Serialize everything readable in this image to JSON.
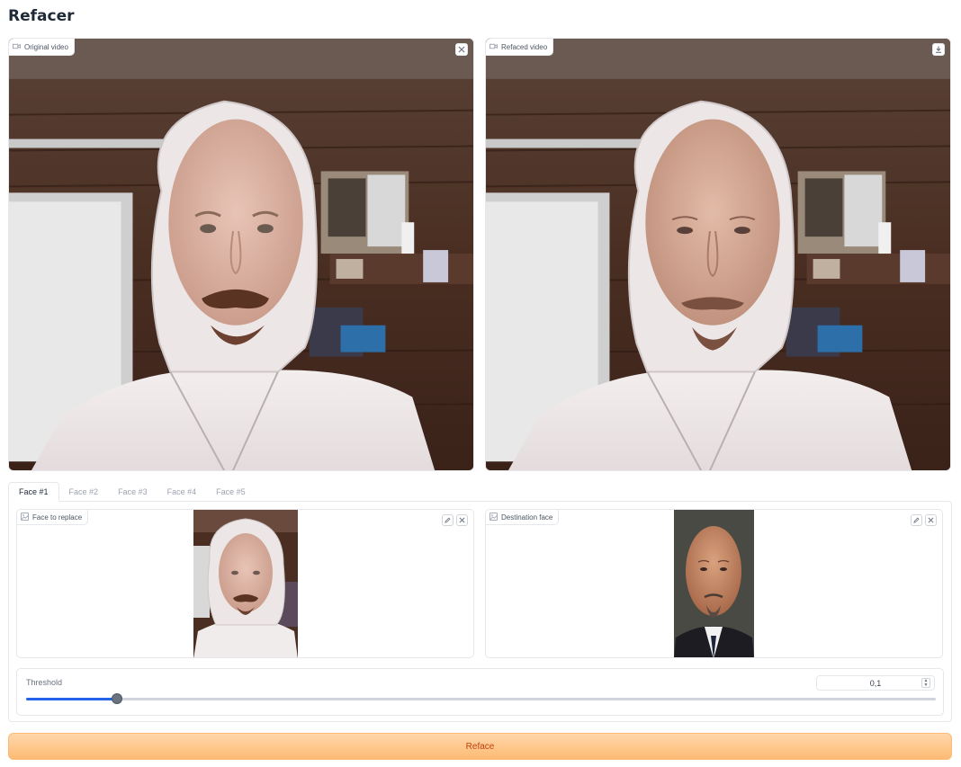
{
  "app": {
    "title": "Refacer"
  },
  "original_video": {
    "label": "Original video",
    "icon": "video-icon",
    "action_icon": "close-icon"
  },
  "refaced_video": {
    "label": "Refaced video",
    "icon": "video-icon",
    "action_icon": "download-icon"
  },
  "tabs": [
    {
      "label": "Face #1",
      "active": true
    },
    {
      "label": "Face #2",
      "active": false
    },
    {
      "label": "Face #3",
      "active": false
    },
    {
      "label": "Face #4",
      "active": false
    },
    {
      "label": "Face #5",
      "active": false
    }
  ],
  "face_to_replace": {
    "label": "Face to replace",
    "icon": "image-icon"
  },
  "destination_face": {
    "label": "Destination face",
    "icon": "image-icon"
  },
  "threshold": {
    "label": "Threshold",
    "value": "0,1",
    "fraction": 0.1
  },
  "reface_button": {
    "label": "Reface"
  },
  "colors": {
    "accent": "#2563eb",
    "button": "#fdba74",
    "button_text": "#c2410c"
  }
}
